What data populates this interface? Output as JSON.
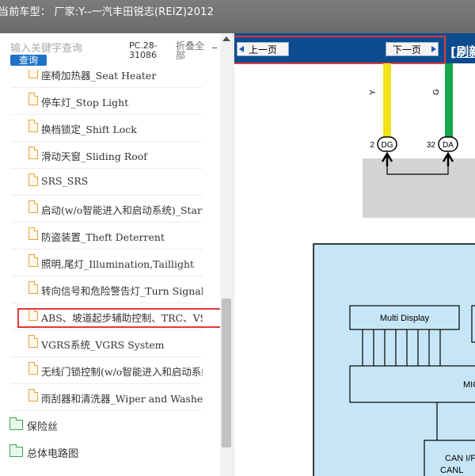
{
  "header": {
    "title": "当前车型： 厂家:Y--一汽丰田锐志(REIZ)2012"
  },
  "search": {
    "placeholder": "输入关键字查询",
    "button": "查询"
  },
  "toolbar": {
    "code": "PC.28-31086",
    "collapse_all": "折叠全部"
  },
  "tree": {
    "items": [
      {
        "label": "座椅加热器_Seat Heater"
      },
      {
        "label": "停车灯_Stop Light"
      },
      {
        "label": "换档锁定_Shift Lock"
      },
      {
        "label": "滑动天窗_Sliding Roof"
      },
      {
        "label": "SRS_SRS"
      },
      {
        "label": "启动(w/o智能进入和启动系统)_Starting("
      },
      {
        "label": "防盗装置_Theft Deterrent"
      },
      {
        "label": "照明,尾灯_Illumination,Taillight"
      },
      {
        "label": "转向信号和危险警告灯_Turn Signal and"
      },
      {
        "label": "ABS、坡道起步辅助控制、TRC、VSC -"
      },
      {
        "label": "VGRS系统_VGRS System"
      },
      {
        "label": "无线门锁控制(w/o智能进入和启动系统)"
      },
      {
        "label": "雨刮器和清洗器_Wiper and Washer"
      }
    ],
    "selected_index": 9,
    "folders": [
      {
        "label": "保险丝"
      },
      {
        "label": "总体电路图"
      }
    ]
  },
  "viewer": {
    "prev_button": "上一页",
    "next_button": "下一页",
    "refresh": "[刷新",
    "diagram": {
      "wire_left": "Y",
      "wire_right": "G",
      "pin_left_num": "2",
      "pin_left_code": "DG",
      "pin_right_num": "32",
      "pin_right_code": "DA",
      "multi_display": "Multi Display",
      "mic": "MIC",
      "can_if": "CAN I/F",
      "canl": "CANL"
    }
  },
  "colors": {
    "header_bg": "#707070",
    "nav_bg": "#0c4b8e",
    "highlight": "#e53935",
    "wire_yellow": "#f3e21a",
    "wire_green": "#14a84a",
    "module_fill": "#c6e6f7"
  }
}
